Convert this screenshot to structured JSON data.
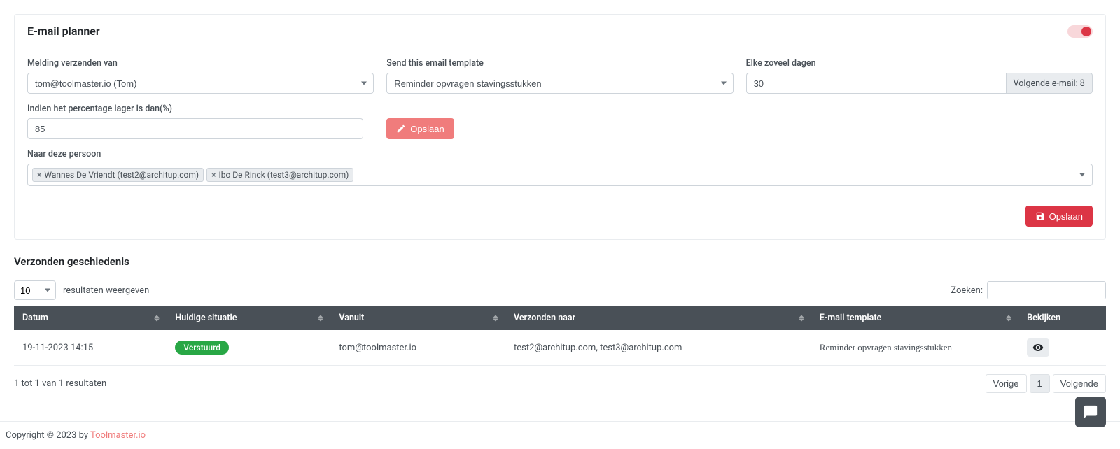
{
  "card": {
    "title": "E-mail planner",
    "labels": {
      "from": "Melding verzenden van",
      "template": "Send this email template",
      "days": "Elke zoveel dagen",
      "next_email": "Volgende e-mail: 8",
      "percent": "Indien het percentage lager is dan(%)",
      "to": "Naar deze persoon"
    },
    "values": {
      "from": "tom@toolmaster.io (Tom)",
      "template": "Reminder opvragen stavingsstukken",
      "days": "30",
      "percent": "85"
    },
    "tags": [
      "Wannes De Vriendt (test2@architup.com)",
      "Ibo De Rinck (test3@architup.com)"
    ],
    "buttons": {
      "save_inline": "Opslaan",
      "save_footer": "Opslaan"
    }
  },
  "history": {
    "title": "Verzonden geschiedenis",
    "length_value": "10",
    "length_label": "resultaten weergeven",
    "search_label": "Zoeken:",
    "columns": {
      "date": "Datum",
      "status": "Huidige situatie",
      "from": "Vanuit",
      "to": "Verzonden naar",
      "template": "E-mail template",
      "view": "Bekijken"
    },
    "row": {
      "date": "19-11-2023 14:15",
      "status": "Verstuurd",
      "from": "tom@toolmaster.io",
      "to": "test2@architup.com, test3@architup.com",
      "template": "Reminder opvragen stavingsstukken"
    },
    "info": "1 tot 1 van 1 resultaten",
    "pagination": {
      "prev": "Vorige",
      "page": "1",
      "next": "Volgende"
    }
  },
  "footer": {
    "text": "Copyright © 2023 by ",
    "link": "Toolmaster.io"
  }
}
